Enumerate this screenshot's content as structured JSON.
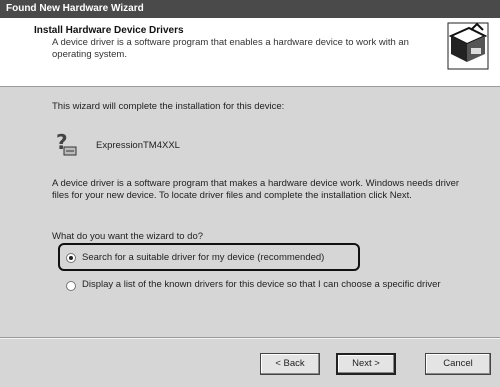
{
  "window": {
    "title": "Found New Hardware Wizard"
  },
  "header": {
    "title": "Install Hardware Device Drivers",
    "subtitle": "A device driver is a software program that enables a hardware device to work with an operating system.",
    "icon": "hardware-wizard-icon"
  },
  "intro_text": "This wizard will complete the installation for this device:",
  "device": {
    "name": "ExpressionTM4XXL",
    "icon": "unknown-device-icon"
  },
  "description": "A device driver is a software program that makes a hardware device work. Windows needs driver files for your new device. To locate driver files and complete the installation click Next.",
  "question": "What do you want the wizard to do?",
  "options": [
    {
      "label": "Search for a suitable driver for my device (recommended)",
      "selected": true
    },
    {
      "label": "Display a list of the known drivers for this device so that I can choose a specific driver",
      "selected": false
    }
  ],
  "buttons": {
    "back": "< Back",
    "next": "Next >",
    "cancel": "Cancel"
  }
}
